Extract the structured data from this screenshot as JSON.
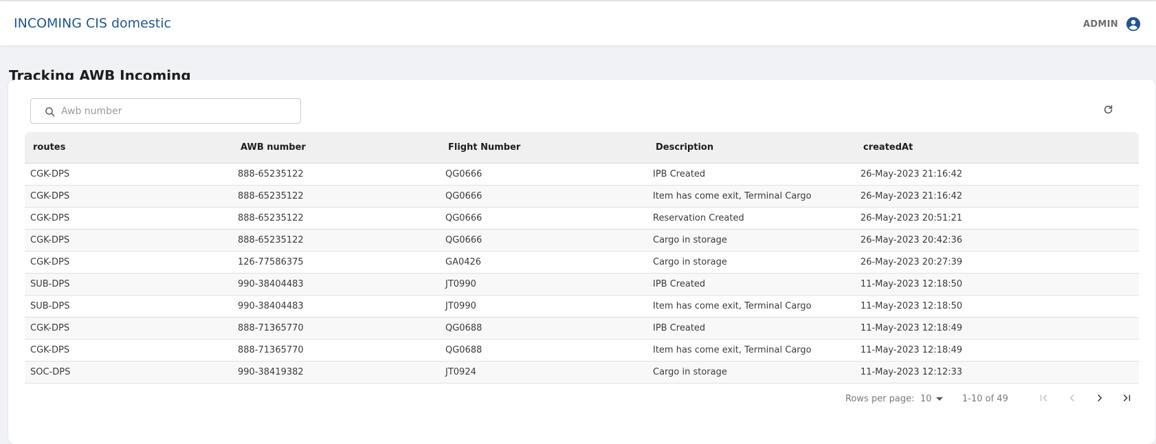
{
  "app": {
    "title": "INCOMING CIS domestic",
    "user": "ADMIN"
  },
  "page": {
    "title": "Tracking AWB Incoming"
  },
  "search": {
    "placeholder": "Awb number",
    "value": ""
  },
  "table": {
    "columns": [
      "routes",
      "AWB number",
      "Flight Number",
      "Description",
      "createdAt"
    ],
    "rows": [
      [
        "CGK-DPS",
        "888-65235122",
        "QG0666",
        "IPB Created",
        "26-May-2023 21:16:42"
      ],
      [
        "CGK-DPS",
        "888-65235122",
        "QG0666",
        "Item has come exit, Terminal Cargo",
        "26-May-2023 21:16:42"
      ],
      [
        "CGK-DPS",
        "888-65235122",
        "QG0666",
        "Reservation Created",
        "26-May-2023 20:51:21"
      ],
      [
        "CGK-DPS",
        "888-65235122",
        "QG0666",
        "Cargo in storage",
        "26-May-2023 20:42:36"
      ],
      [
        "CGK-DPS",
        "126-77586375",
        "GA0426",
        "Cargo in storage",
        "26-May-2023 20:27:39"
      ],
      [
        "SUB-DPS",
        "990-38404483",
        "JT0990",
        "IPB Created",
        "11-May-2023 12:18:50"
      ],
      [
        "SUB-DPS",
        "990-38404483",
        "JT0990",
        "Item has come exit, Terminal Cargo",
        "11-May-2023 12:18:50"
      ],
      [
        "CGK-DPS",
        "888-71365770",
        "QG0688",
        "IPB Created",
        "11-May-2023 12:18:49"
      ],
      [
        "CGK-DPS",
        "888-71365770",
        "QG0688",
        "Item has come exit, Terminal Cargo",
        "11-May-2023 12:18:49"
      ],
      [
        "SOC-DPS",
        "990-38419382",
        "JT0924",
        "Cargo in storage",
        "11-May-2023 12:12:33"
      ]
    ]
  },
  "pagination": {
    "rows_per_page_label": "Rows per page:",
    "rows_per_page": "10",
    "range": "1-10 of 49"
  },
  "icons": {
    "user": "account-circle-icon",
    "search": "search-icon",
    "refresh": "refresh-icon",
    "first": "first-page-icon",
    "prev": "chevron-left-icon",
    "next": "chevron-right-icon",
    "last": "last-page-icon"
  },
  "colors": {
    "brand": "#1f5690",
    "header_bg": "#f0f0f0",
    "page_bg": "#f1f2f5"
  }
}
